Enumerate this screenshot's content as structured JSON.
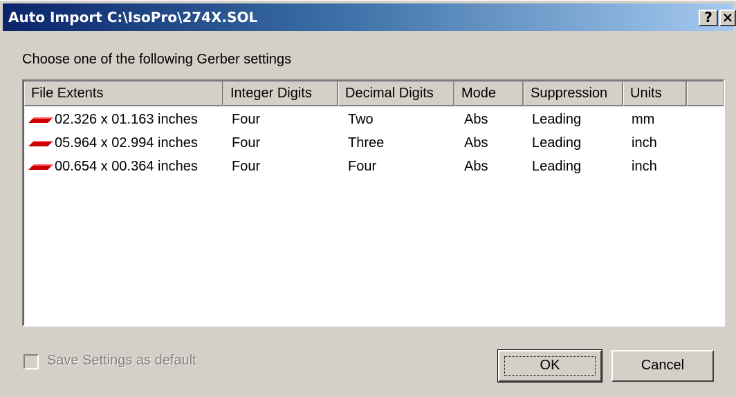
{
  "window": {
    "title": "Auto Import C:\\IsoPro\\274X.SOL",
    "help_label": "?",
    "close_label": "×"
  },
  "prompt": "Choose one of the following Gerber settings",
  "table": {
    "columns": [
      "File Extents",
      "Integer Digits",
      "Decimal Digits",
      "Mode",
      "Suppression",
      "Units"
    ],
    "rows": [
      {
        "extents": "02.326 x 01.163 inches",
        "integer": "Four",
        "decimal": "Two",
        "mode": "Abs",
        "suppression": "Leading",
        "units": "mm"
      },
      {
        "extents": "05.964 x 02.994 inches",
        "integer": "Four",
        "decimal": "Three",
        "mode": "Abs",
        "suppression": "Leading",
        "units": "inch"
      },
      {
        "extents": "00.654 x 00.364 inches",
        "integer": "Four",
        "decimal": "Four",
        "mode": "Abs",
        "suppression": "Leading",
        "units": "inch"
      }
    ],
    "row_icon": "gerber-layer-icon",
    "icon_color": "#cc0000"
  },
  "footer": {
    "save_default_label": "Save Settings as default",
    "save_default_checked": false,
    "save_default_enabled": false
  },
  "buttons": {
    "ok": "OK",
    "cancel": "Cancel"
  }
}
